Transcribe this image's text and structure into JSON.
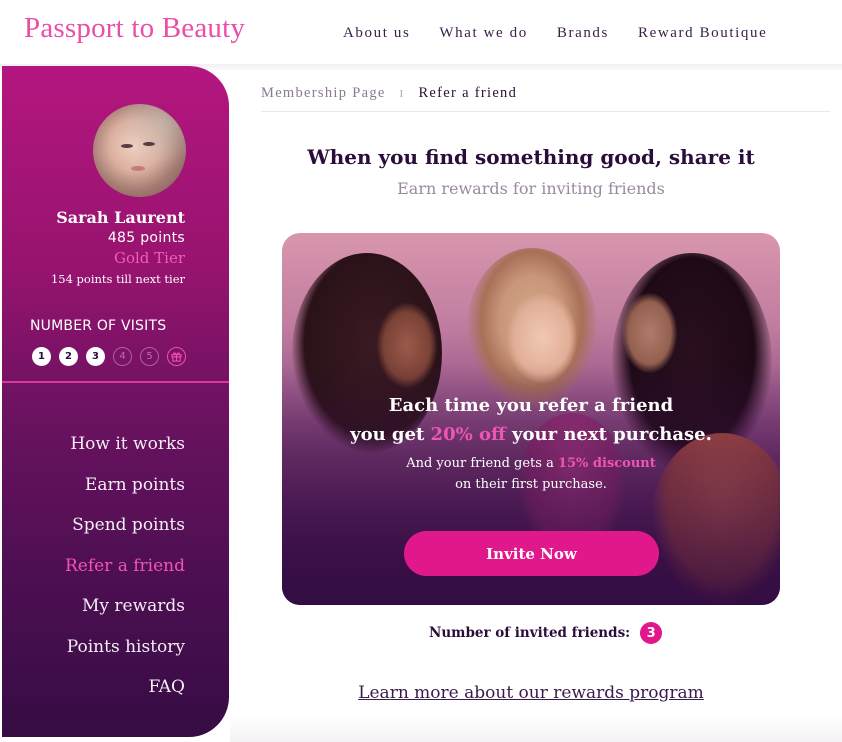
{
  "header": {
    "logo": "Passport to Beauty",
    "nav": [
      "About us",
      "What we do",
      "Brands",
      "Reward Boutique"
    ]
  },
  "sidebar": {
    "user": {
      "name": "Sarah Laurent",
      "points": "485  points",
      "tier": "Gold Tier",
      "next_tier": "154 points till next tier"
    },
    "visits": {
      "title": "NUMBER OF VISITS",
      "steps": [
        {
          "label": "1",
          "state": "done"
        },
        {
          "label": "2",
          "state": "done"
        },
        {
          "label": "3",
          "state": "done"
        },
        {
          "label": "4",
          "state": "todo"
        },
        {
          "label": "5",
          "state": "todo"
        },
        {
          "label": "gift-icon",
          "state": "reward"
        }
      ],
      "completed": 3,
      "total": 5
    },
    "menu": [
      {
        "label": "How it works",
        "active": false
      },
      {
        "label": "Earn points",
        "active": false
      },
      {
        "label": "Spend points",
        "active": false
      },
      {
        "label": "Refer a friend",
        "active": true
      },
      {
        "label": "My rewards",
        "active": false
      },
      {
        "label": "Points history",
        "active": false
      },
      {
        "label": "FAQ",
        "active": false
      }
    ]
  },
  "breadcrumb": {
    "root": "Membership Page",
    "separator": "I",
    "current": "Refer a friend"
  },
  "main": {
    "title": "When you find something good, share it",
    "subtitle": "Earn rewards for inviting friends",
    "card": {
      "line1": "Each time you refer a friend",
      "line2_pre": "you get ",
      "line2_hl": "20% off",
      "line2_post": " your next purchase.",
      "p_pre": "And your friend gets a ",
      "p_hl": "15% discount",
      "p_post": "on their first purchase.",
      "button": "Invite Now"
    },
    "invited_label": "Number of invited friends:",
    "invited_count": "3",
    "learn_more": "Learn more about our rewards program"
  },
  "colors": {
    "brand_pink": "#ea4ea6",
    "accent": "#e0188c",
    "active_link": "#f054b4",
    "dark": "#2a0d3a"
  }
}
